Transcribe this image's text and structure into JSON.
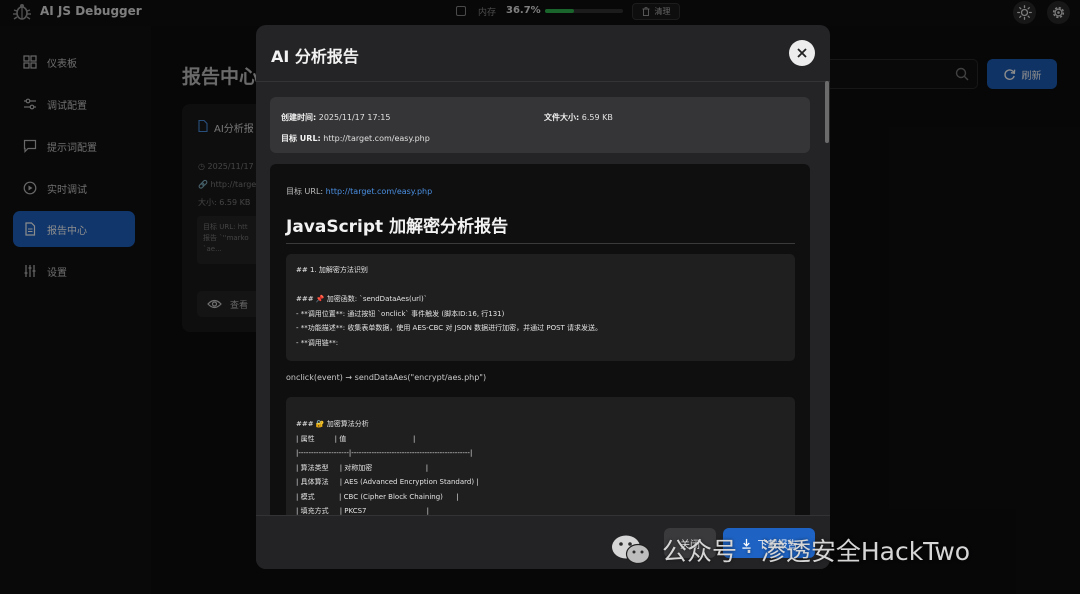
{
  "app": {
    "title": "AI JS Debugger"
  },
  "topbar": {
    "memory_label": "内存",
    "memory_value": "36.7%",
    "memory_fraction": 0.367,
    "clean_label": "清理"
  },
  "sidebar": {
    "items": [
      {
        "label": "仪表板",
        "icon": "dashboard-icon"
      },
      {
        "label": "调试配置",
        "icon": "sliders-icon"
      },
      {
        "label": "提示词配置",
        "icon": "chat-icon"
      },
      {
        "label": "实时调试",
        "icon": "play-icon"
      },
      {
        "label": "报告中心",
        "icon": "document-icon",
        "active": true
      },
      {
        "label": "设置",
        "icon": "settings-sliders-icon"
      }
    ]
  },
  "main": {
    "heading": "报告中心",
    "refresh_label": "刷新",
    "card": {
      "title": "AI分析报",
      "date": "2025/11/17",
      "url": "http://target",
      "size": "大小: 6.59 KB",
      "snippet": "目标 URL: htt\n报告 `''marko\n`ae...",
      "view_label": "查看"
    }
  },
  "modal": {
    "title": "AI 分析报告",
    "info": {
      "created_label": "创建时间:",
      "created_value": "2025/11/17 17:15",
      "size_label": "文件大小:",
      "size_value": "6.59 KB",
      "url_label": "目标 URL:",
      "url_value": "http://target.com/easy.php"
    },
    "report": {
      "target_prefix": "目标 URL: ",
      "target_link": "http://target.com/easy.php",
      "heading": "JavaScript 加解密分析报告",
      "block1": "## 1. 加解密方法识别\n\n### 📌 加密函数: `sendDataAes(url)`\n- **调用位置**: 通过按钮 `onclick` 事件触发 (脚本ID:16, 行131)\n- **功能描述**: 收集表单数据，使用 AES-CBC 对 JSON 数据进行加密，并通过 POST 请求发送。\n- **调用链**:",
      "flow": "onclick(event) → sendDataAes(\"encrypt/aes.php\")",
      "block2": "### 🔐 加密算法分析\n| 属性         | 值                              |\n|--------------------|-----------------------------------------------|\n| 算法类型     | 对称加密                        |\n| 具体算法     | AES (Advanced Encryption Standard) |\n| 模式           | CBC (Cipher Block Chaining)      |\n| 填充方式     | PKCS7                           |"
    },
    "footer": {
      "close_label": "关闭",
      "download_label": "下载报告"
    }
  },
  "watermark": {
    "text": "公众号 · 渗透安全HackTwo"
  }
}
